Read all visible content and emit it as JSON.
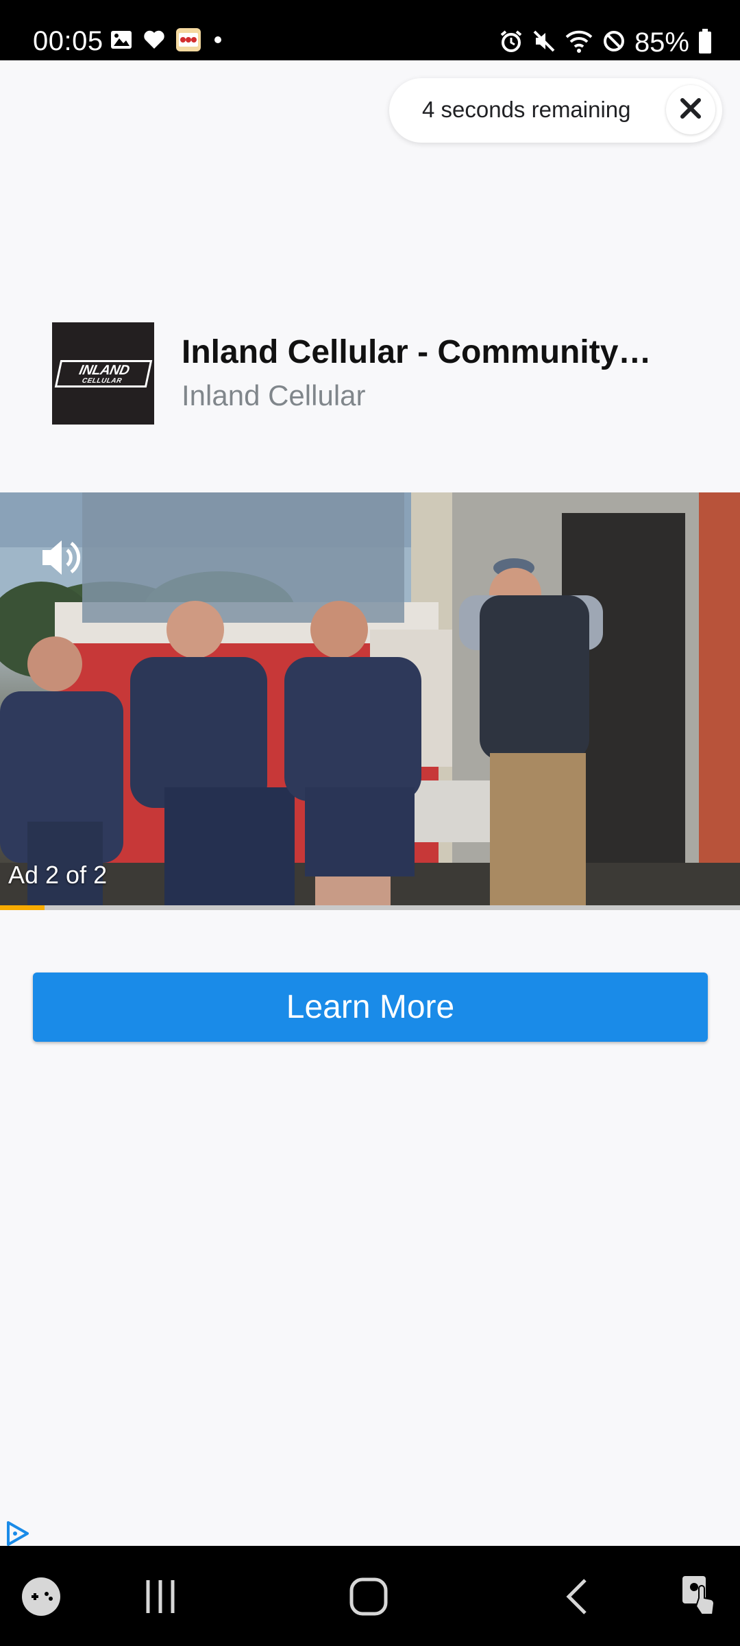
{
  "status_bar": {
    "time": "00:05",
    "battery": "85%",
    "left_icons": [
      "gallery-icon",
      "heart-icon",
      "slots-app-icon",
      "dot-icon"
    ],
    "right_icons": [
      "alarm-icon",
      "mute-icon",
      "wifi-icon",
      "do-not-disturb-icon",
      "battery-icon"
    ]
  },
  "countdown": {
    "text": "4 seconds remaining",
    "close_icon": "close-icon"
  },
  "advertiser": {
    "logo_text": "INLAND",
    "logo_subtext": "CELLULAR",
    "title": "Inland Cellular - Community…",
    "name": "Inland Cellular"
  },
  "video": {
    "sound_icon": "volume-icon",
    "ad_counter": "Ad 2 of 2",
    "progress": 0.06
  },
  "cta": {
    "label": "Learn More"
  },
  "adchoices_icon": "adchoices-icon",
  "nav_bar": {
    "items": [
      "game-launcher-icon",
      "recents-icon",
      "home-icon",
      "back-icon",
      "accessibility-icon"
    ]
  },
  "colors": {
    "cta": "#1a8be8",
    "progress": "#f9ab00",
    "background": "#f8f8fa"
  }
}
